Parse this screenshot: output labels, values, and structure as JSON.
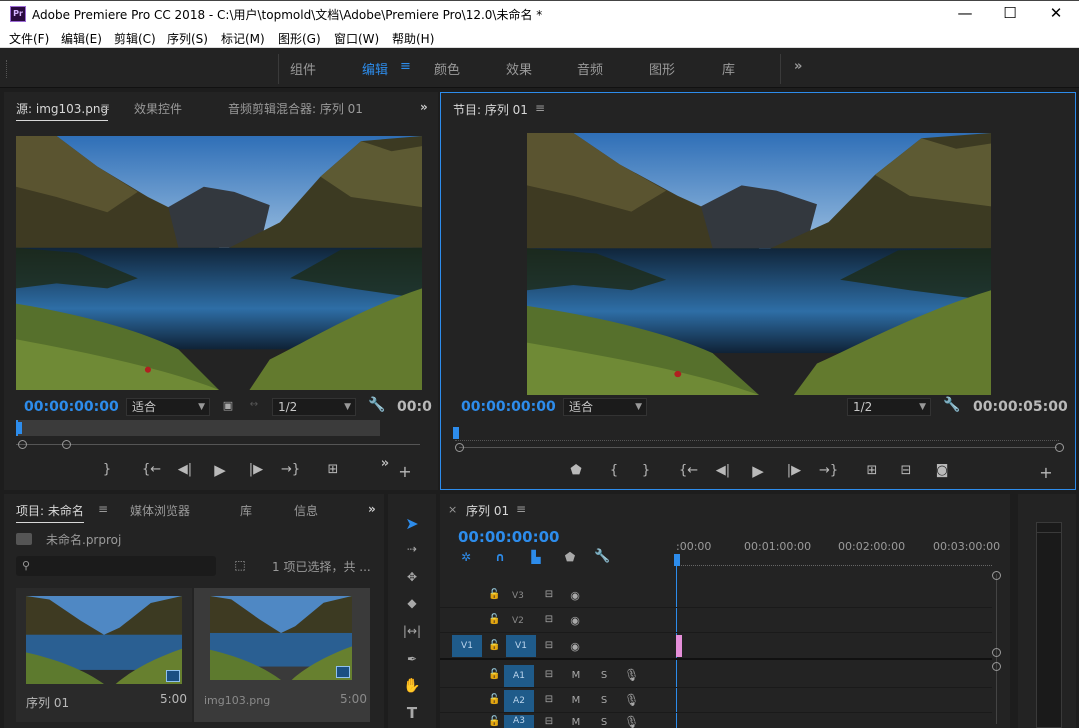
{
  "window": {
    "title": "Adobe Premiere Pro CC 2018 - C:\\用户\\topmold\\文档\\Adobe\\Premiere Pro\\12.0\\未命名 *",
    "logo": "Pr",
    "minimize": "—",
    "maximize": "☐",
    "close": "✕"
  },
  "menu": [
    "文件(F)",
    "编辑(E)",
    "剪辑(C)",
    "序列(S)",
    "标记(M)",
    "图形(G)",
    "窗口(W)",
    "帮助(H)"
  ],
  "workspaces": {
    "items": [
      "组件",
      "编辑",
      "颜色",
      "效果",
      "音频",
      "图形",
      "库"
    ],
    "active": "编辑",
    "more": "»"
  },
  "source_panel": {
    "tabs": [
      "源: img103.png",
      "效果控件",
      "音频剪辑混合器: 序列 01"
    ],
    "menu_icon": "≡",
    "more": "»",
    "timecode": "00:00:00:00",
    "fit": "适合",
    "resolution": "1/2",
    "end_timecode": "00:0"
  },
  "program_panel": {
    "tab": "节目: 序列 01",
    "menu_icon": "≡",
    "timecode": "00:00:00:00",
    "fit": "适合",
    "resolution": "1/2",
    "end_timecode": "00:00:05:00"
  },
  "project_panel": {
    "tabs": [
      "项目: 未命名",
      "媒体浏览器",
      "库",
      "信息"
    ],
    "more": "»",
    "project_file": "未命名.prproj",
    "search_placeholder": "",
    "selection_info": "1 项已选择，共 ...",
    "items": [
      {
        "name": "序列 01",
        "duration": "5:00"
      },
      {
        "name": "img103.png",
        "duration": "5:00"
      }
    ]
  },
  "timeline": {
    "close": "×",
    "tab": "序列 01",
    "menu_icon": "≡",
    "timecode": "00:00:00:00",
    "ruler": [
      ":00:00",
      "00:01:00:00",
      "00:02:00:00",
      "00:03:00:00"
    ],
    "video_tracks": [
      "V3",
      "V2",
      "V1"
    ],
    "audio_tracks": [
      "A1",
      "A2",
      "A3"
    ],
    "source_patch": "V1",
    "track_m": "M",
    "track_s": "S"
  },
  "colors": {
    "accent": "#2d8ceb",
    "panel": "#232323",
    "track_selected": "#1f5b8a",
    "clip": "#e58fd9"
  }
}
